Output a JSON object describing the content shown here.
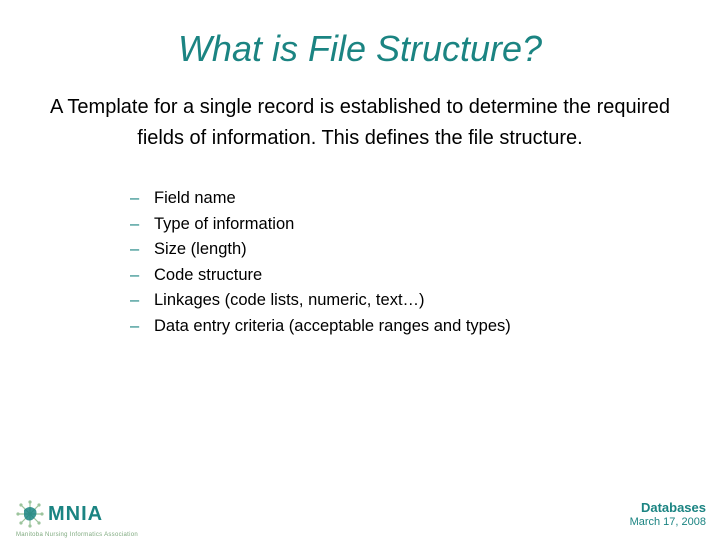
{
  "title": "What is File Structure?",
  "intro": "A Template for a single record is established to determine the required fields of information.  This defines the file structure.",
  "bullets": [
    "Field name",
    "Type of information",
    "Size (length)",
    "Code structure",
    "Linkages (code lists, numeric, text…)",
    "Data entry criteria (acceptable ranges and types)"
  ],
  "logo": {
    "text": "MNIA",
    "subtitle": "Manitoba Nursing Informatics Association"
  },
  "footer": {
    "label": "Databases",
    "date": "March 17, 2008"
  }
}
